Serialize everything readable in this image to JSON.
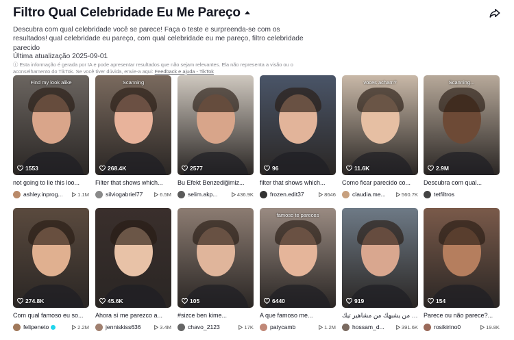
{
  "page": {
    "title": "Filtro Qual Celebridade Eu Me Pareço",
    "description": "Descubra com qual celebridade você se parece! Faça o teste e surpreenda-se com os resultados! qual celebridade eu pareço, com qual celebridade eu me pareço, filtro celebridade parecido",
    "updated": "Última atualização 2025-09-01",
    "disclaimer_text": "Esta informação é gerada por IA e pode apresentar resultados que não sejam relevantes. Ela não representa a visão ou o aconselhamento do TikTok. Se você tiver dúvida, envie-a aqui: ",
    "disclaimer_link": "Feedback e ajuda - TikTok"
  },
  "icons": {
    "share": "share-icon",
    "caret": "caret-up-icon",
    "like": "heart-icon",
    "views": "play-icon"
  },
  "cards": [
    {
      "title": "not going to lie this loo...",
      "likes": "1553",
      "author": "ashley.inprog...",
      "views": "1.1M",
      "overlay": "Find my look alike",
      "bg": "#6b6560",
      "face": "#d9a58a",
      "avatar": "#b98a6a"
    },
    {
      "title": "Filter that shows which...",
      "likes": "268.4K",
      "author": "silviogabriel77",
      "views": "6.5M",
      "overlay": "Scanning",
      "bg": "#7a6a5e",
      "face": "#e8b39b",
      "avatar": "#8a8a8a"
    },
    {
      "title": "Bu Efekt Benzediğimiz...",
      "likes": "2577",
      "author": "selim.akp...",
      "views": "436.9K",
      "overlay": "",
      "bg": "#cfc8bf",
      "face": "#d8a58a",
      "avatar": "#5a5a5a"
    },
    {
      "title": "filter that shows which...",
      "likes": "96",
      "author": "frozen.edit37",
      "views": "8646",
      "overlay": "",
      "bg": "#4a5568",
      "face": "#e2b49a",
      "avatar": "#333333"
    },
    {
      "title": "Como ficar parecido co...",
      "likes": "11.6K",
      "author": "claudia.me...",
      "views": "560.7K",
      "overlay": "voces acham?",
      "bg": "#c9b9a8",
      "face": "#e6bfa3",
      "avatar": "#c7a07f"
    },
    {
      "title": "Descubra com qual...",
      "likes": "2.9M",
      "author": "tetfiltros",
      "views": "",
      "overlay": "Scanning...",
      "bg": "#b7a99a",
      "face": "#6d4a36",
      "avatar": "#444444"
    },
    {
      "title": "Com qual famoso eu so...",
      "likes": "274.8K",
      "author": "felipeneto",
      "views": "2.2M",
      "overlay": "",
      "bg": "#5a4a3e",
      "face": "#e0b090",
      "avatar": "#a0785a",
      "verified": true
    },
    {
      "title": "Ahora sí me parezco a...",
      "likes": "45.6K",
      "author": "jenniskiss636",
      "views": "3.4M",
      "overlay": "",
      "bg": "#3a2f2c",
      "face": "#e8c2a7",
      "avatar": "#a08070"
    },
    {
      "title": "#sizce ben kime...",
      "likes": "105",
      "author": "chavo_2123",
      "views": "17K",
      "overlay": "",
      "bg": "#8c7c72",
      "face": "#e0b59b",
      "avatar": "#666666"
    },
    {
      "title": "A que famoso me...",
      "likes": "6440",
      "author": "patycamb",
      "views": "1.2M",
      "overlay": "famoso te pareces",
      "bg": "#9a8b82",
      "face": "#e5b59a",
      "avatar": "#c08878"
    },
    {
      "title": "تر يبين من يشبهك من مشاهير تيك",
      "likes": "919",
      "author": "hossam_d...",
      "views": "391.6K",
      "overlay": "",
      "bg": "#6e7a86",
      "face": "#d9a78f",
      "avatar": "#7a6a60"
    },
    {
      "title": "Parece ou não parece?...",
      "likes": "154",
      "author": "rosikirino0",
      "views": "19.8K",
      "overlay": "",
      "bg": "#7a5a4a",
      "face": "#b57e5e",
      "avatar": "#9a6a5a"
    }
  ]
}
